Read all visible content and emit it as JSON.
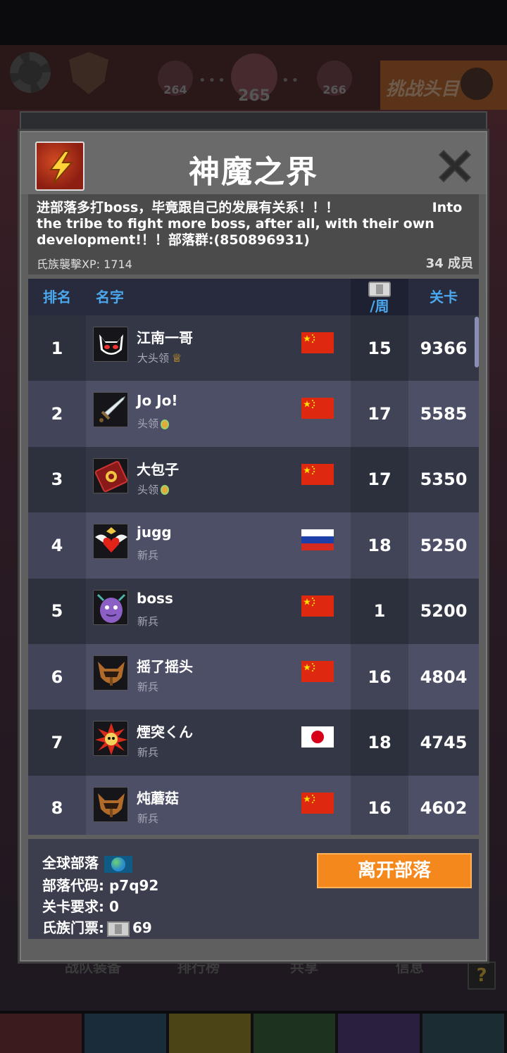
{
  "background": {
    "levels": [
      "264",
      "265",
      "266"
    ],
    "challenge_label": "挑战头目",
    "tab_labels": [
      "战队装备",
      "排行榜",
      "共享",
      "信息"
    ],
    "help_label": "?",
    "bottom_tab_colors": [
      "#3b1b1b",
      "#1a2b3a",
      "#4a4416",
      "#1d3320",
      "#2a1f3d",
      "#1c2c33"
    ]
  },
  "dialog": {
    "title": "神魔之界",
    "close_icon": "close-icon",
    "description": "进部落多打boss，毕竟跟自己的发展有关系！！！                    Into the tribe to fight more boss, after all, with their own development!！！部落群:(850896931)",
    "xp_label": "氏族襲擊XP: 1714",
    "members_label": "34 成员"
  },
  "table": {
    "headers": {
      "rank": "排名",
      "name": "名字",
      "week": "/周",
      "stage": "关卡"
    },
    "rows": [
      {
        "rank": "1",
        "name": "江南一哥",
        "role": "大头领",
        "badge": "crown",
        "flag": "cn",
        "week": "15",
        "stage": "9366",
        "avatar": "demon-mask"
      },
      {
        "rank": "2",
        "name": "Jo Jo!",
        "role": "头领",
        "badge": "medal",
        "flag": "cn",
        "week": "17",
        "stage": "5585",
        "avatar": "sword"
      },
      {
        "rank": "3",
        "name": "大包子",
        "role": "头领",
        "badge": "medal",
        "flag": "cn",
        "week": "17",
        "stage": "5350",
        "avatar": "spellbook"
      },
      {
        "rank": "4",
        "name": "jugg",
        "role": "新兵",
        "badge": "",
        "flag": "ru",
        "week": "18",
        "stage": "5250",
        "avatar": "winged-heart"
      },
      {
        "rank": "5",
        "name": "boss",
        "role": "新兵",
        "badge": "",
        "flag": "cn",
        "week": "1",
        "stage": "5200",
        "avatar": "purple-monster"
      },
      {
        "rank": "6",
        "name": "摇了摇头",
        "role": "新兵",
        "badge": "",
        "flag": "cn",
        "week": "16",
        "stage": "4804",
        "avatar": "horned-helmet"
      },
      {
        "rank": "7",
        "name": "煙突くん",
        "role": "新兵",
        "badge": "",
        "flag": "jp",
        "week": "18",
        "stage": "4745",
        "avatar": "flame-skull"
      },
      {
        "rank": "8",
        "name": "炖蘑菇",
        "role": "新兵",
        "badge": "",
        "flag": "cn",
        "week": "16",
        "stage": "4602",
        "avatar": "horned-helmet"
      }
    ]
  },
  "footer": {
    "global_label": "全球部落",
    "code_label": "部落代码: p7q92",
    "requirement_label": "关卡要求:  0",
    "ticket_label": "氏族门票:",
    "ticket_value": "69",
    "leave_button": "离开部落"
  },
  "colors": {
    "accent_blue": "#4aa8ee",
    "leave_orange": "#f5881c",
    "row_dark": "#343746",
    "row_light": "#4c4f66"
  }
}
